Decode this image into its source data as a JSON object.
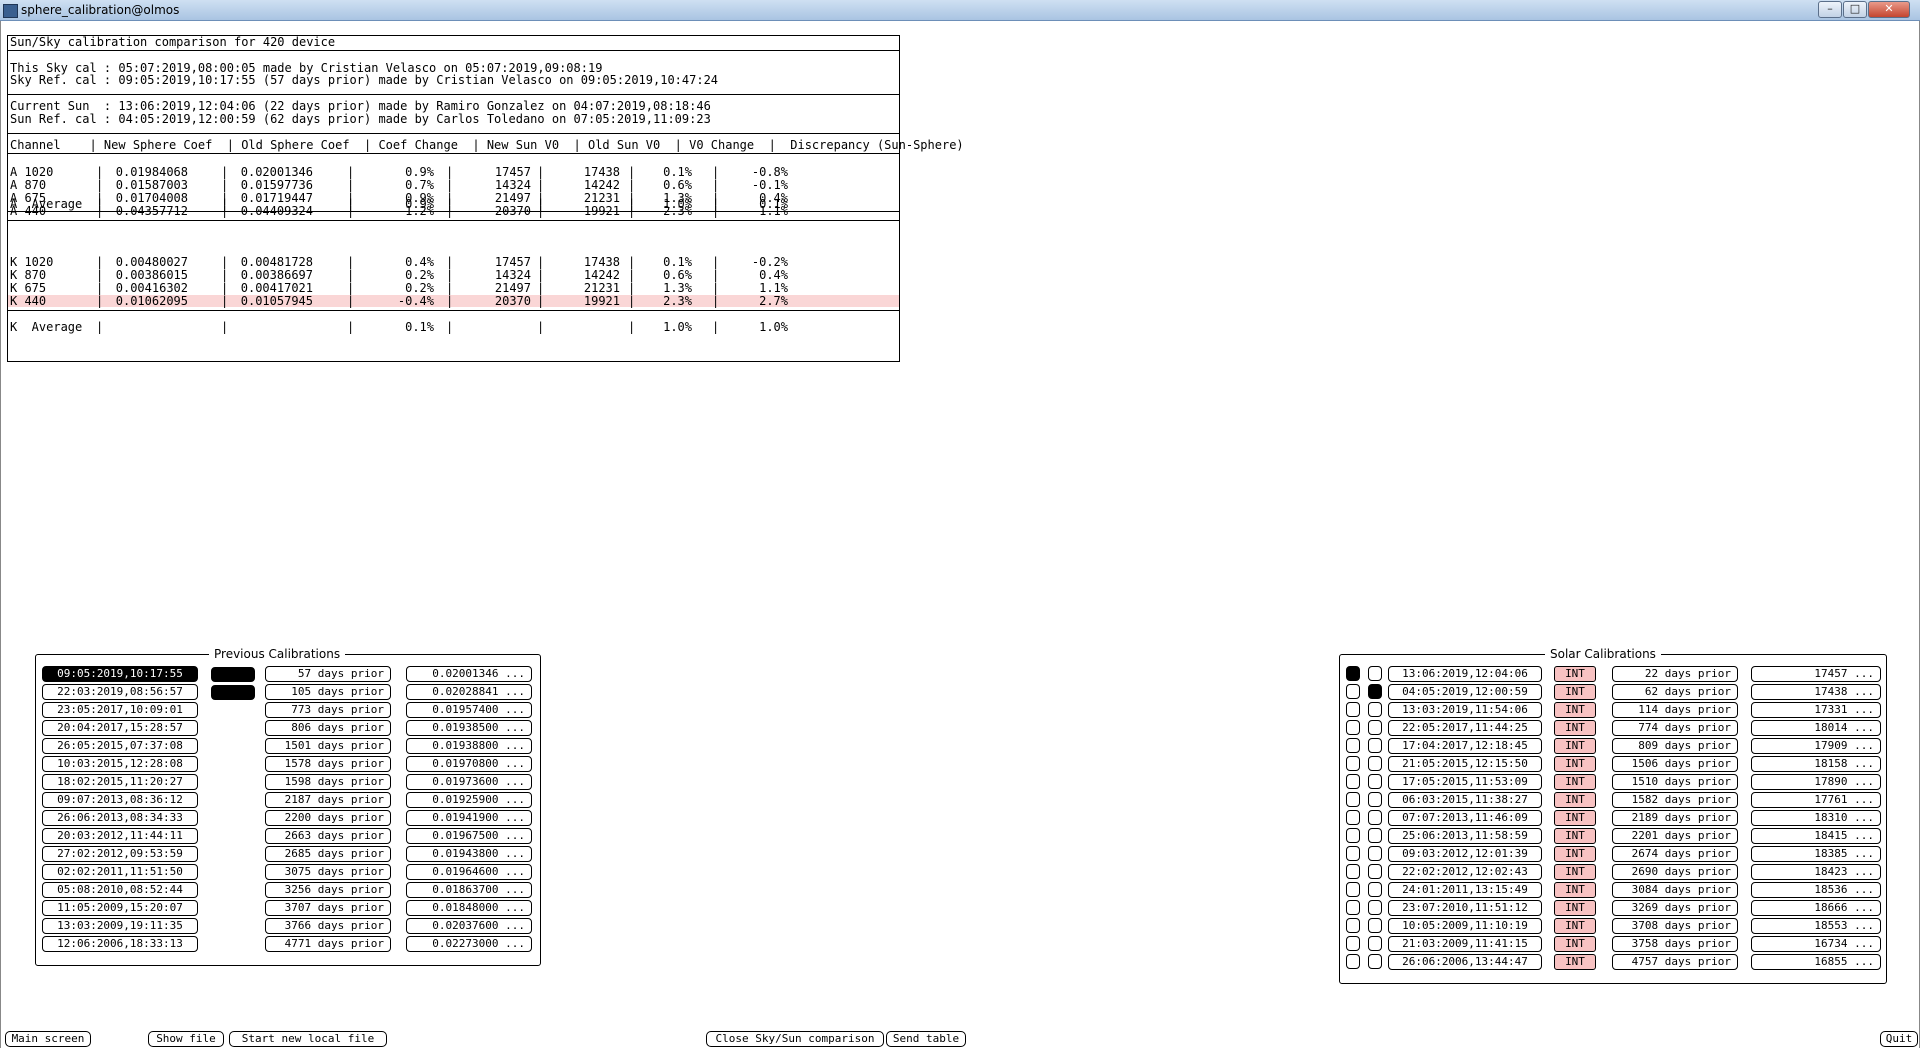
{
  "window": {
    "title": "sphere_calibration@olmos",
    "buttons": [
      "–",
      "□",
      "✕"
    ]
  },
  "report": {
    "title": "Sun/Sky calibration comparison for 420 device",
    "sky_lines": [
      "This Sky cal : 05:07:2019,08:00:05 made by Cristian Velasco on 05:07:2019,09:08:19",
      "Sky Ref. cal : 09:05:2019,10:17:55 (57 days prior) made by Cristian Velasco on 09:05:2019,10:47:24"
    ],
    "sun_lines": [
      "Current Sun  : 13:06:2019,12:04:06 (22 days prior) made by Ramiro Gonzalez on 04:07:2019,08:18:46",
      "Sun Ref. cal : 04:05:2019,12:00:59 (62 days prior) made by Carlos Toledano on 07:05:2019,11:09:23"
    ],
    "header": "Channel    | New Sphere Coef  | Old Sphere Coef  | Coef Change  | New Sun V0  | Old Sun V0  | V0 Change  |  Discrepancy (Sun-Sphere)",
    "columns": [
      "Channel",
      "New Sphere Coef",
      "Old Sphere Coef",
      "Coef Change",
      "New Sun V0",
      "Old Sun V0",
      "V0 Change",
      "Discrepancy (Sun-Sphere)"
    ],
    "a_rows": [
      [
        "A 1020",
        "0.01984068",
        "0.02001346",
        "0.9%",
        "17457",
        "17438",
        "0.1%",
        "-0.8%"
      ],
      [
        "A 870",
        "0.01587003",
        "0.01597736",
        "0.7%",
        "14324",
        "14242",
        "0.6%",
        "-0.1%"
      ],
      [
        "A 675",
        "0.01704008",
        "0.01719447",
        "0.9%",
        "21497",
        "21231",
        "1.3%",
        "0.4%"
      ],
      [
        "A 440",
        "0.04357712",
        "0.04409324",
        "1.2%",
        "20370",
        "19921",
        "2.3%",
        "1.1%"
      ]
    ],
    "a_avg": [
      "A  Average",
      "",
      "",
      "0.9%",
      "",
      "",
      "1.0%",
      "0.1%"
    ],
    "k_rows": [
      [
        "K 1020",
        "0.00480027",
        "0.00481728",
        "0.4%",
        "17457",
        "17438",
        "0.1%",
        "-0.2%"
      ],
      [
        "K 870",
        "0.00386015",
        "0.00386697",
        "0.2%",
        "14324",
        "14242",
        "0.6%",
        "0.4%"
      ],
      [
        "K 675",
        "0.00416302",
        "0.00417021",
        "0.2%",
        "21497",
        "21231",
        "1.3%",
        "1.1%"
      ],
      [
        "K 440",
        "0.01062095",
        "0.01057945",
        "-0.4%",
        "20370",
        "19921",
        "2.3%",
        "2.7%"
      ]
    ],
    "k_avg": [
      "K  Average",
      "",
      "",
      "0.1%",
      "",
      "",
      "1.0%",
      "1.0%"
    ],
    "highlight_color": "#fad6d6"
  },
  "previous": {
    "title": "Previous Calibrations",
    "rows": [
      {
        "date": "09:05:2019,10:17:55",
        "prior": "57 days prior",
        "coef": "0.02001346 ...",
        "selected": true,
        "marked": true
      },
      {
        "date": "22:03:2019,08:56:57",
        "prior": "105 days prior",
        "coef": "0.02028841 ...",
        "selected": false,
        "marked": true
      },
      {
        "date": "23:05:2017,10:09:01",
        "prior": "773 days prior",
        "coef": "0.01957400 ...",
        "selected": false,
        "marked": false
      },
      {
        "date": "20:04:2017,15:28:57",
        "prior": "806 days prior",
        "coef": "0.01938500 ...",
        "selected": false,
        "marked": false
      },
      {
        "date": "26:05:2015,07:37:08",
        "prior": "1501 days prior",
        "coef": "0.01938800 ...",
        "selected": false,
        "marked": false
      },
      {
        "date": "10:03:2015,12:28:08",
        "prior": "1578 days prior",
        "coef": "0.01970800 ...",
        "selected": false,
        "marked": false
      },
      {
        "date": "18:02:2015,11:20:27",
        "prior": "1598 days prior",
        "coef": "0.01973600 ...",
        "selected": false,
        "marked": false
      },
      {
        "date": "09:07:2013,08:36:12",
        "prior": "2187 days prior",
        "coef": "0.01925900 ...",
        "selected": false,
        "marked": false
      },
      {
        "date": "26:06:2013,08:34:33",
        "prior": "2200 days prior",
        "coef": "0.01941900 ...",
        "selected": false,
        "marked": false
      },
      {
        "date": "20:03:2012,11:44:11",
        "prior": "2663 days prior",
        "coef": "0.01967500 ...",
        "selected": false,
        "marked": false
      },
      {
        "date": "27:02:2012,09:53:59",
        "prior": "2685 days prior",
        "coef": "0.01943800 ...",
        "selected": false,
        "marked": false
      },
      {
        "date": "02:02:2011,11:51:50",
        "prior": "3075 days prior",
        "coef": "0.01964600 ...",
        "selected": false,
        "marked": false
      },
      {
        "date": "05:08:2010,08:52:44",
        "prior": "3256 days prior",
        "coef": "0.01863700 ...",
        "selected": false,
        "marked": false
      },
      {
        "date": "11:05:2009,15:20:07",
        "prior": "3707 days prior",
        "coef": "0.01848000 ...",
        "selected": false,
        "marked": false
      },
      {
        "date": "13:03:2009,19:11:35",
        "prior": "3766 days prior",
        "coef": "0.02037600 ...",
        "selected": false,
        "marked": false
      },
      {
        "date": "12:06:2006,18:33:13",
        "prior": "4771 days prior",
        "coef": "0.02273000 ...",
        "selected": false,
        "marked": false
      }
    ]
  },
  "solar": {
    "title": "Solar Calibrations",
    "int_label": "INT",
    "int_color": "#f8c2c2",
    "rows": [
      {
        "r1": true,
        "r2": false,
        "date": "13:06:2019,12:04:06",
        "prior": "22 days prior",
        "v0": "17457 ..."
      },
      {
        "r1": false,
        "r2": true,
        "date": "04:05:2019,12:00:59",
        "prior": "62 days prior",
        "v0": "17438 ..."
      },
      {
        "r1": false,
        "r2": false,
        "date": "13:03:2019,11:54:06",
        "prior": "114 days prior",
        "v0": "17331 ..."
      },
      {
        "r1": false,
        "r2": false,
        "date": "22:05:2017,11:44:25",
        "prior": "774 days prior",
        "v0": "18014 ..."
      },
      {
        "r1": false,
        "r2": false,
        "date": "17:04:2017,12:18:45",
        "prior": "809 days prior",
        "v0": "17909 ..."
      },
      {
        "r1": false,
        "r2": false,
        "date": "21:05:2015,12:15:50",
        "prior": "1506 days prior",
        "v0": "18158 ..."
      },
      {
        "r1": false,
        "r2": false,
        "date": "17:05:2015,11:53:09",
        "prior": "1510 days prior",
        "v0": "17890 ..."
      },
      {
        "r1": false,
        "r2": false,
        "date": "06:03:2015,11:38:27",
        "prior": "1582 days prior",
        "v0": "17761 ..."
      },
      {
        "r1": false,
        "r2": false,
        "date": "07:07:2013,11:46:09",
        "prior": "2189 days prior",
        "v0": "18310 ..."
      },
      {
        "r1": false,
        "r2": false,
        "date": "25:06:2013,11:58:59",
        "prior": "2201 days prior",
        "v0": "18415 ..."
      },
      {
        "r1": false,
        "r2": false,
        "date": "09:03:2012,12:01:39",
        "prior": "2674 days prior",
        "v0": "18385 ..."
      },
      {
        "r1": false,
        "r2": false,
        "date": "22:02:2012,12:02:43",
        "prior": "2690 days prior",
        "v0": "18423 ..."
      },
      {
        "r1": false,
        "r2": false,
        "date": "24:01:2011,13:15:49",
        "prior": "3084 days prior",
        "v0": "18536 ..."
      },
      {
        "r1": false,
        "r2": false,
        "date": "23:07:2010,11:51:12",
        "prior": "3269 days prior",
        "v0": "18666 ..."
      },
      {
        "r1": false,
        "r2": false,
        "date": "10:05:2009,11:10:19",
        "prior": "3708 days prior",
        "v0": "18553 ..."
      },
      {
        "r1": false,
        "r2": false,
        "date": "21:03:2009,11:41:15",
        "prior": "3758 days prior",
        "v0": "16734 ..."
      },
      {
        "r1": false,
        "r2": false,
        "date": "26:06:2006,13:44:47",
        "prior": "4757 days prior",
        "v0": "16855 ..."
      }
    ]
  },
  "bottom_buttons": {
    "main": "Main screen",
    "show_file": "Show file",
    "start_new": "Start new local file",
    "close_cmp": "Close Sky/Sun comparison",
    "send_table": "Send table",
    "quit": "Quit"
  }
}
